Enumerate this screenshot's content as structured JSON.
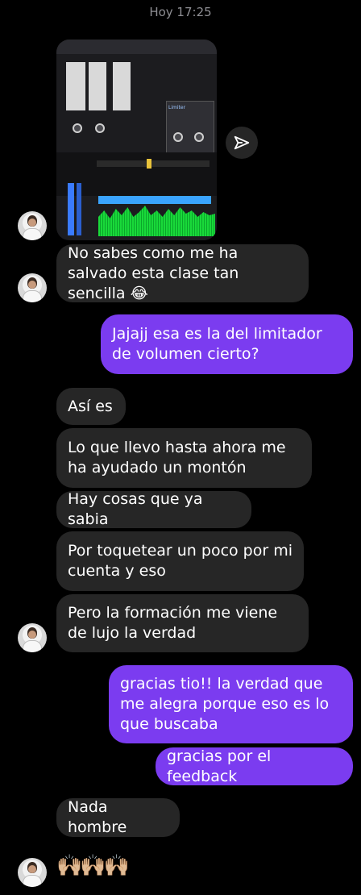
{
  "header": {
    "timestamp": "Hoy 17:25"
  },
  "photo": {
    "dialog_title": "Limiter"
  },
  "messages": [
    {
      "side": "in",
      "text": "No sabes como me ha salvado esta clase tan sencilla 😂"
    },
    {
      "side": "out",
      "text": "Jajajj esa es la del limitador de volumen cierto?"
    },
    {
      "side": "in",
      "text": "Así es"
    },
    {
      "side": "in",
      "text": "Lo que llevo hasta ahora me ha ayudado un montón"
    },
    {
      "side": "in",
      "text": "Hay cosas que ya sabia"
    },
    {
      "side": "in",
      "text": "Por toquetear un poco por mi cuenta y eso"
    },
    {
      "side": "in",
      "text": "Pero la formación me viene de lujo la verdad"
    },
    {
      "side": "out",
      "text": "gracias tio!! la verdad que me alegra porque eso es lo que buscaba"
    },
    {
      "side": "out",
      "text": "gracias por el feedback"
    },
    {
      "side": "in",
      "text": "Nada hombre"
    }
  ],
  "reaction": {
    "text": "🙌🏼🙌🏼🙌🏼"
  },
  "colors": {
    "incoming": "#262626",
    "outgoing": "#7b3cf0",
    "background": "#000000"
  }
}
